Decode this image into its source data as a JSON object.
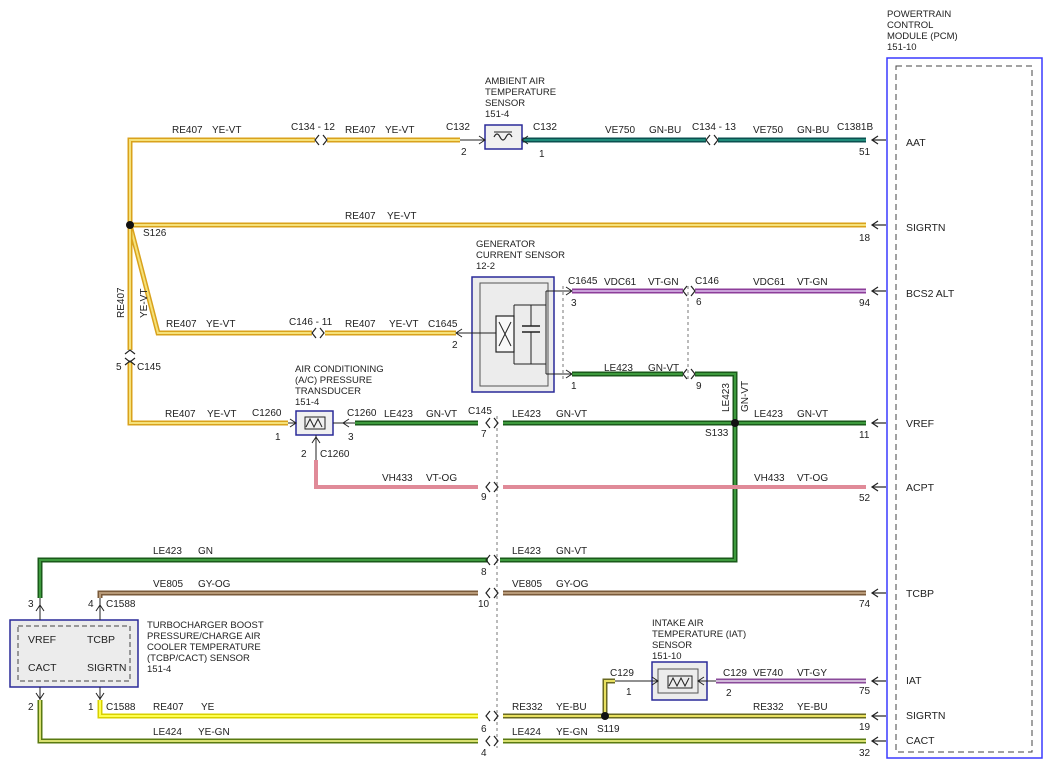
{
  "colors": {
    "re_ye_vt_outer": "#d9a21c",
    "re_ye_vt_inner": "#f5e17a",
    "gn_bu_outer": "#0b5050",
    "gn_bu_inner": "#1f8b7a",
    "vt_gn_outer": "#8d3d9a",
    "vt_gn_inner": "#c9a0d8",
    "gn_vt_outer": "#1a5a1a",
    "gn_vt_inner": "#3d9a3d",
    "vt_og": "#e08a98",
    "gy_og_outer": "#7a5a3a",
    "gy_og_inner": "#b89a78",
    "ye_outer": "#d8d000",
    "ye_inner": "#ffff50",
    "ye_gn_outer": "#5a7a10",
    "ye_gn_inner": "#d8e070",
    "ye_bu_outer": "#6a6a20",
    "ye_bu_inner": "#e8e060",
    "vt_gy_outer": "#8a4a9a",
    "vt_gy_inner": "#d0b8d8",
    "pcm_border": "#3a3aff",
    "component_border": "#2a2a99"
  },
  "pcm": {
    "title": [
      "POWERTRAIN",
      "CONTROL",
      "MODULE (PCM)",
      "151-10"
    ],
    "pins": [
      {
        "signal": "AAT",
        "pin": "51",
        "connector": "C1381B"
      },
      {
        "signal": "SIGRTN",
        "pin": "18"
      },
      {
        "signal": "BCS2 ALT",
        "pin": "94"
      },
      {
        "signal": "VREF",
        "pin": "11"
      },
      {
        "signal": "ACPT",
        "pin": "52"
      },
      {
        "signal": "TCBP",
        "pin": "74"
      },
      {
        "signal": "IAT",
        "pin": "75"
      },
      {
        "signal": "SIGRTN",
        "pin": "19"
      },
      {
        "signal": "CACT",
        "pin": "32"
      }
    ]
  },
  "components": {
    "aat_sensor": {
      "title": [
        "AMBIENT AIR",
        "TEMPERATURE",
        "SENSOR",
        "151-4"
      ],
      "conn_left": "C132",
      "conn_right": "C132",
      "pin_left": "2",
      "pin_right": "1"
    },
    "gen_sensor": {
      "title": [
        "GENERATOR",
        "CURRENT SENSOR",
        "12-2"
      ],
      "conn": "C1645",
      "pins": [
        "3",
        "2",
        "1"
      ],
      "conn_left": "C1645"
    },
    "ac_sensor": {
      "title": [
        "AIR CONDITIONING",
        "(A/C) PRESSURE",
        "TRANSDUCER",
        "151-4"
      ],
      "conn_left": "C1260",
      "conn_right": "C1260",
      "conn_bottom": "C1260",
      "pins": [
        "1",
        "3",
        "2"
      ]
    },
    "tcbp_sensor": {
      "title": [
        "TURBOCHARGER BOOST",
        "PRESSURE/CHARGE AIR",
        "COOLER TEMPERATURE",
        "(TCBP/CACT) SENSOR",
        "151-4"
      ],
      "labels": [
        "VREF",
        "TCBP",
        "CACT",
        "SIGRTN"
      ],
      "pins": [
        "3",
        "4",
        "2",
        "1"
      ],
      "conn_top": "C1588",
      "conn_bottom": "C1588"
    },
    "iat_sensor": {
      "title": [
        "INTAKE AIR",
        "TEMPERATURE (IAT)",
        "SENSOR",
        "151-10"
      ],
      "conn_left": "C129",
      "conn_right": "C129",
      "pins": [
        "1",
        "2"
      ]
    }
  },
  "wires": {
    "re407_ye_vt": [
      "RE407",
      "YE-VT"
    ],
    "ve750_gn_bu": [
      "VE750",
      "GN-BU"
    ],
    "vdc61_vt_gn": [
      "VDC61",
      "VT-GN"
    ],
    "le423_gn_vt": [
      "LE423",
      "GN-VT"
    ],
    "le423_gn": [
      "LE423",
      "GN"
    ],
    "vh433_vt_og": [
      "VH433",
      "VT-OG"
    ],
    "ve805_gy_og": [
      "VE805",
      "GY-OG"
    ],
    "ve740_vt_gy": [
      "VE740",
      "VT-GY"
    ],
    "re407_ye": [
      "RE407",
      "YE"
    ],
    "re332_ye_bu": [
      "RE332",
      "YE-BU"
    ],
    "le424_ye_gn": [
      "LE424",
      "YE-GN"
    ]
  },
  "connectors": {
    "c134_12": "C134 - 12",
    "c134_13": "C134 - 13",
    "c146_11": "C146 - 11",
    "c146": "C146",
    "c145": "C145",
    "c145_pin5": "5",
    "c146_pin": "6",
    "c146_pin9": "9",
    "c145_pins": [
      "7",
      "9",
      "8",
      "10",
      "6",
      "4"
    ]
  },
  "splices": {
    "s126": "S126",
    "s133": "S133",
    "s119": "S119"
  }
}
